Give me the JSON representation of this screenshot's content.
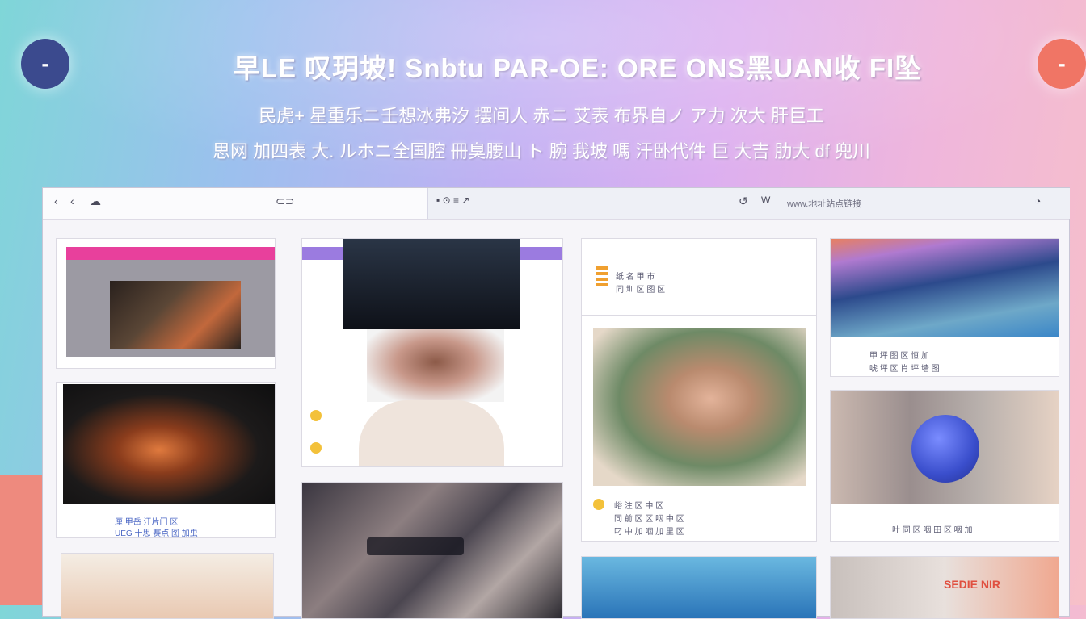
{
  "header": {
    "title": "早LE 叹玥坡! Snbtu PAR-OE: ORE ONS黑UAN收 FI坠",
    "subtitle_1": "民虎+ 星重乐ニ壬想冰弗汐 摆间人 赤ニ 艾表 布界自ノ ア力 次大 肝巨工",
    "subtitle_2": "思网 加四表 大. ルホニ全国腔 冊臭腰山 ト 腕 我坡 嗎 汗卧代件 巨 大吉 肋大 df 兜川"
  },
  "side_buttons": {
    "left_symbol": "-",
    "right_symbol": "-"
  },
  "toolbar": {
    "left_icons": [
      "‹",
      "‹",
      "☁"
    ],
    "tab_icon": "⊂⊃",
    "url_text": "▪ ⊙ ≡ ↗",
    "right_icons": [
      "↺",
      "W"
    ],
    "url_bar_text": "www.地址站点链接",
    "profile_icon": "◔"
  },
  "cards": {
    "col1": {
      "caption_1": "厘 甲岳 汗片门 区",
      "caption_2": "UEG 十思 赛点 图 加虫"
    },
    "col3": {
      "top_caption_1": "纸 名 甲 市",
      "top_caption_2": "同 圳 区 图 区",
      "photo_caption_1": "峪 注 区 中 区",
      "photo_caption_2": "同 前 区 区 咽 中 区",
      "photo_caption_3": "叼 中 加 咽 加 里 区"
    },
    "col4": {
      "sky_caption_1": "甲 坪 图 区 恒 加",
      "sky_caption_2": "唬 坪 区 肖 坪 墙 图",
      "blue_caption": "叶 同 区 咽 田 区 咽 加",
      "bottom_text": "SEDIE NIR"
    }
  },
  "colors": {
    "accent_pink": "#e8409c",
    "accent_purple": "#8a5ce0",
    "coral": "#ee8a7e",
    "navy": "#3b4a8e"
  }
}
